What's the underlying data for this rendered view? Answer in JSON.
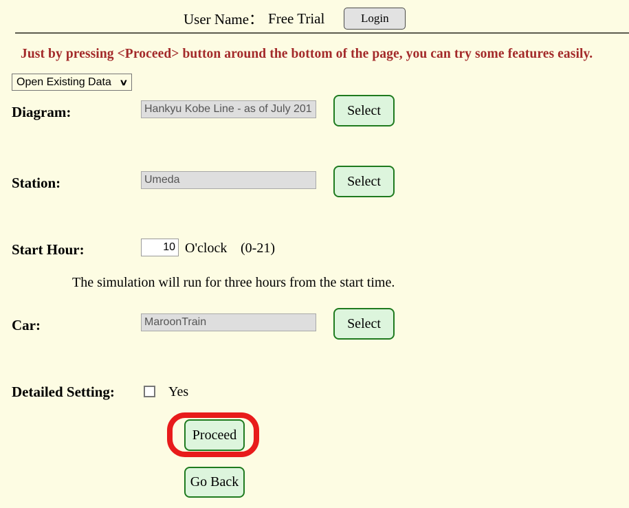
{
  "header": {
    "user_label": "User Name：",
    "user_value": "Free Trial",
    "login_label": "Login"
  },
  "notice": {
    "text": "Just by pressing <Proceed> button around the bottom of the page, you can try some features easily.",
    "color": "#a32a2a"
  },
  "mode_select": {
    "selected": "Open Existing Data",
    "caret": "∨"
  },
  "fields": {
    "diagram": {
      "label": "Diagram:",
      "value": "Hankyu Kobe Line - as of July 201",
      "button": "Select"
    },
    "station": {
      "label": "Station:",
      "value": "Umeda",
      "button": "Select"
    },
    "start_hour": {
      "label": "Start Hour:",
      "value": "10",
      "unit": "O'clock",
      "range": "(0-21)",
      "note": "The simulation will run for three hours from the start time."
    },
    "car": {
      "label": "Car:",
      "value": "MaroonTrain",
      "button": "Select"
    },
    "detailed_setting": {
      "label": "Detailed Setting:",
      "checkbox_label": "Yes",
      "checked": false
    }
  },
  "actions": {
    "proceed": "Proceed",
    "go_back": "Go Back",
    "highlight_color": "#e81b1b"
  },
  "theme": {
    "background": "#fdfce3",
    "button_green_fill": "#ddf5dd",
    "button_green_border": "#1e7a1e",
    "input_disabled_fill": "#dedede"
  }
}
